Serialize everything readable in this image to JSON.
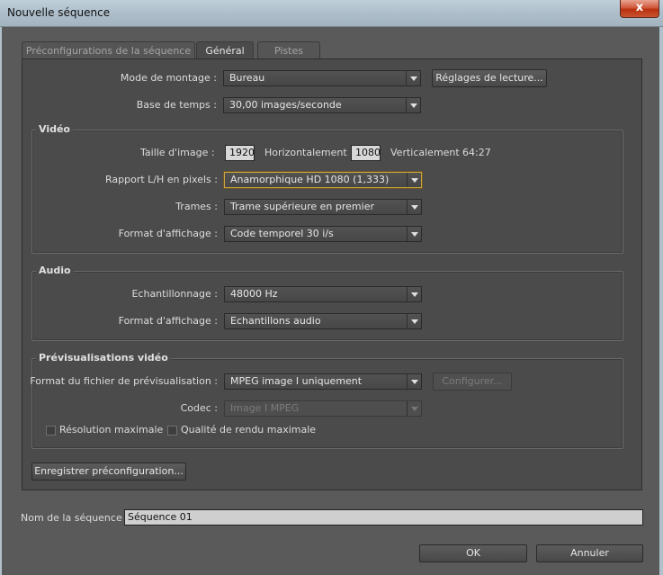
{
  "window": {
    "title": "Nouvelle séquence",
    "close_glyph": "x"
  },
  "tabs": [
    {
      "label": "Préconfigurations de la séquence",
      "active": false
    },
    {
      "label": "Général",
      "active": true
    },
    {
      "label": "Pistes",
      "active": false
    }
  ],
  "general": {
    "editing_mode_label": "Mode de montage :",
    "editing_mode_value": "Bureau",
    "playback_settings_button": "Réglages de lecture...",
    "timebase_label": "Base de temps :",
    "timebase_value": "30,00 images/seconde"
  },
  "video": {
    "title": "Vidéo",
    "frame_size_label": "Taille d'image :",
    "width": "1920",
    "horizontal_label": "Horizontalement",
    "height": "1080",
    "vertical_label": "Verticalement",
    "aspect": "64:27",
    "pixel_aspect_label": "Rapport L/H en pixels :",
    "pixel_aspect_value": "Anamorphique HD 1080 (1,333)",
    "fields_label": "Trames :",
    "fields_value": "Trame supérieure en premier",
    "display_format_label": "Format d'affichage :",
    "display_format_value": "Code temporel 30 i/s"
  },
  "audio": {
    "title": "Audio",
    "sample_rate_label": "Echantillonnage :",
    "sample_rate_value": "48000 Hz",
    "display_format_label": "Format d'affichage :",
    "display_format_value": "Echantillons audio"
  },
  "preview": {
    "title": "Prévisualisations vidéo",
    "file_format_label": "Format du fichier de prévisualisation :",
    "file_format_value": "MPEG image I uniquement",
    "configure_button": "Configurer...",
    "codec_label": "Codec :",
    "codec_value": "Image I MPEG",
    "max_resolution_label": "Résolution maximale",
    "max_quality_label": "Qualité de rendu maximale"
  },
  "save_preset_button": "Enregistrer préconfiguration...",
  "sequence_name_label": "Nom de la séquence :",
  "sequence_name_value": "Séquence 01",
  "ok_button": "OK",
  "cancel_button": "Annuler"
}
